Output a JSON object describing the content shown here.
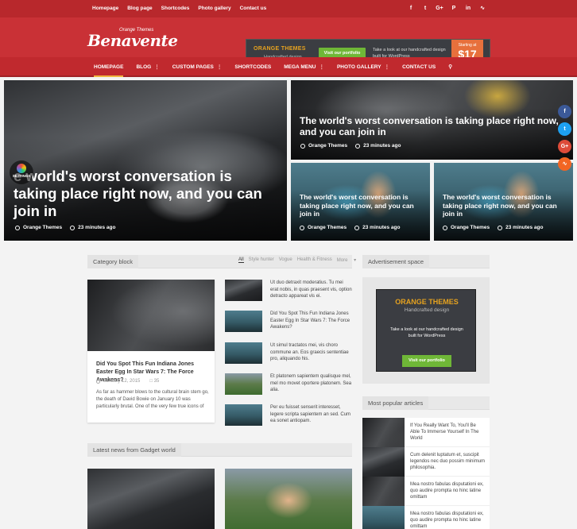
{
  "top_nav": [
    "Homepage",
    "Blog page",
    "Shortcodes",
    "Photo gallery",
    "Contact us"
  ],
  "top_social": [
    "f",
    "t",
    "G+",
    "P",
    "in",
    "rss"
  ],
  "header": {
    "logo": "Benavente",
    "logo_sub": "Orange Themes",
    "banner": {
      "brand": "ORANGE THEMES",
      "brand_sub": "Handcrafted design",
      "button": "Visit our portfolio",
      "text": "Take a look at our handcrafted design built for WordPress",
      "price_label": "Starting at",
      "price": "$17"
    }
  },
  "main_nav": [
    {
      "label": "HOMEPAGE",
      "dropdown": false
    },
    {
      "label": "BLOG",
      "dropdown": true
    },
    {
      "label": "CUSTOM PAGES",
      "dropdown": true
    },
    {
      "label": "SHORTCODES",
      "dropdown": false
    },
    {
      "label": "MEGA MENU",
      "dropdown": true
    },
    {
      "label": "PHOTO GALLERY",
      "dropdown": true
    },
    {
      "label": "CONTACT US",
      "dropdown": false
    }
  ],
  "featured": {
    "big": {
      "title": "e world's worst conversation is taking place right now, and you can join in",
      "author": "Orange Themes",
      "time": "23 minutes ago"
    },
    "top_right": {
      "title": "The world's worst conversation is taking place right now, and you can join in",
      "author": "Orange Themes",
      "time": "23 minutes ago"
    },
    "small_1": {
      "title": "The world's worst conversation is taking place right now, and you can join in",
      "author": "Orange Themes",
      "time": "23 minutes ago"
    },
    "small_2": {
      "title": "The world's worst conversation is taking place right now, and you can join in",
      "author": "Orange Themes",
      "time": "23 minutes ago"
    }
  },
  "settings_label": "SETTINGS",
  "side_share": [
    "f",
    "t",
    "G+",
    "rss"
  ],
  "category_block": {
    "title": "Category block",
    "tabs": [
      "All",
      "Style hunter",
      "Vogue",
      "Health & Fitness",
      "More"
    ],
    "main": {
      "title": "Did You Spot This Fun Indiana Jones Easter Egg In Star Wars 7: The Force Awakens?",
      "date": "January 12, 2015",
      "comments": "35",
      "excerpt": "As far as hammer blows to the cultural brain stem go, the death of David Bowie on January 10 was particularly brutal. One of the very few true icons of"
    },
    "list": [
      "Ut duo detraxit moderatius. Tu mei erat nobis, in quas praesent vis, option detracto appareat vis ei.",
      "Did You Spot This Fun Indiana Jones Easter Egg In Star Wars 7: The Force Awakens?",
      "Ut simul tractatos mei, vis choro commune an. Eos graecis sententiae pro, aliquando his.",
      "Et platonem sapientem qualisque mel, mel mo movet oportere platonem. Sea alia.",
      "Per eu fuisset senserit interesset, legere scripta sapientem an sed. Cum ea sonet antiopam."
    ]
  },
  "sidebar": {
    "ad_title": "Advertisement space",
    "ad": {
      "brand": "ORANGE THEMES",
      "sub": "Handcrafted design",
      "text": "Take a look at our handcrafted design built for WordPress",
      "button": "Visit our portfolio"
    },
    "popular_title": "Most popular articles",
    "popular": [
      "If You Really Want To, You'll Be Able To Immerse Yourself In The World",
      "Cum delenit luptatum et, suscipit legendos nec duo possim minimum philosophia.",
      "Mea nostro fabulas disputationi ex, quo audire prompta no hinc latine omittam",
      "Mea nostro fabulas disputationi ex, quo audire prompta no hinc latine omittam"
    ]
  },
  "latest_title": "Latest news from Gadget world",
  "colors": {
    "brand_red": "#c93136",
    "accent_orange": "#e7703c",
    "accent_green": "#6fb737"
  }
}
